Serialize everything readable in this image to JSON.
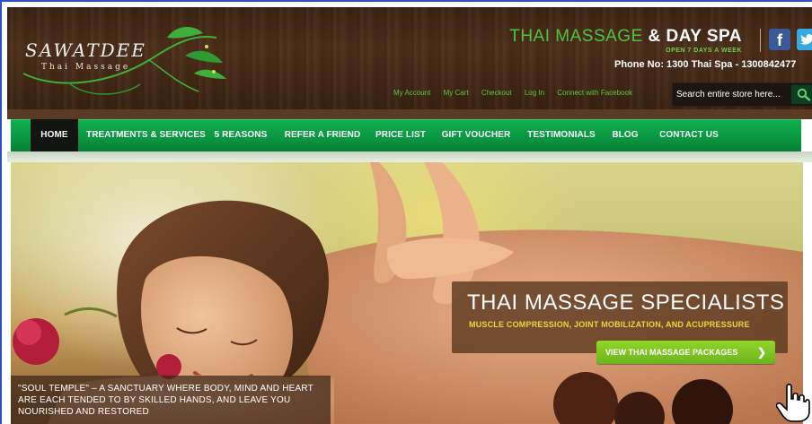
{
  "brand": {
    "logo_main": "SAWATDEE",
    "logo_sub": "Thai Massage"
  },
  "header": {
    "title_green": "THAI MASSAGE",
    "title_white": "& DAY SPA",
    "open_days": "OPEN 7 DAYS A WEEK",
    "phone": "Phone No: 1300 Thai Spa - 1300842477",
    "links": [
      "My Account",
      "My Cart",
      "Checkout",
      "Log In",
      "Connect with Facebook"
    ],
    "social": [
      "facebook-icon",
      "twitter-icon"
    ]
  },
  "search": {
    "placeholder": "Search entire store here..."
  },
  "nav": {
    "items": [
      "HOME",
      "TREATMENTS & SERVICES",
      "5 REASONS",
      "REFER A FRIEND",
      "PRICE LIST",
      "GIFT VOUCHER",
      "TESTIMONIALS",
      "BLOG",
      "CONTACT US"
    ],
    "active": "HOME"
  },
  "hero": {
    "title": "THAI MASSAGE SPECIALISTS",
    "subtitle": "MUSCLE COMPRESSION, JOINT MOBILIZATION, AND ACUPRESSURE",
    "button": "VIEW THAI MASSAGE PACKAGES",
    "quote": "\"SOUL TEMPLE\" – A SANCTUARY WHERE BODY, MIND AND HEART ARE EACH TENDED TO BY SKILLED HANDS, AND LEAVE YOU NOURISHED AND RESTORED"
  },
  "colors": {
    "accent_green": "#0a9842",
    "title_green": "#4fc33f",
    "link_green": "#5cc545",
    "button_green": "#7fc626",
    "subtitle_yellow": "#f0d43a",
    "wood_brown": "#4e2f1a"
  }
}
